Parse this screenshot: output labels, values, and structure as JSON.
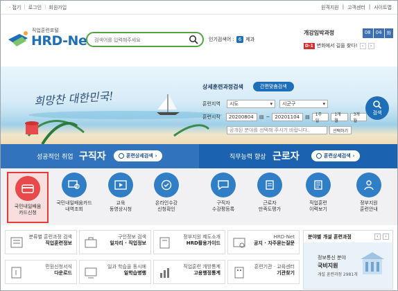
{
  "topbar": {
    "left_links": [
      "· 접기",
      "로그인",
      "회원가입"
    ],
    "right_links": [
      "원격지원",
      "고객센터",
      "사이트맵"
    ]
  },
  "logo": {
    "sub": "직업훈련포털",
    "main": "HRD-Net"
  },
  "search": {
    "placeholder": "검색어를 입력해주세요"
  },
  "popular": {
    "label": "인기검색어 :",
    "rank": "6",
    "term": "제과"
  },
  "deadline": {
    "title": "개강임박과정",
    "date": [
      "08",
      "04",
      "화"
    ],
    "badge": "D-1",
    "text": "변화에서 길을 찾다!"
  },
  "hero": {
    "slogan": "희망찬 대한민국!"
  },
  "panel": {
    "title": "상세훈련과정검색",
    "simple_btn": "간편맞춤검색",
    "region_label": "훈련지역",
    "region_sel": "시도",
    "district_sel": "시군구",
    "start_label": "훈련시작",
    "start_from": "20200804",
    "start_to": "20201104",
    "periods": [
      "1주일",
      "1개월",
      "3개월"
    ],
    "keyword_placeholder": "공개된 분야를 선택해 주시기 바랍니다.",
    "pick_btn": "선택하기",
    "search_btn": "검색"
  },
  "band": {
    "left_small": "성공적인 취업",
    "left_big": "구직자",
    "left_btn": "훈련상세검색",
    "right_small": "직무능력 향상",
    "right_big": "근로자",
    "right_btn": "훈련상세검색"
  },
  "services": [
    {
      "l1": "국민내일배움",
      "l2": "카드신청",
      "icon": "card-icon"
    },
    {
      "l1": "국민내일배움카드",
      "l2": "내역조회",
      "icon": "card-search-icon"
    },
    {
      "l1": "교육",
      "l2": "동영상시청",
      "icon": "video-icon"
    },
    {
      "l1": "온라인수강",
      "l2": "신청확인",
      "icon": "check-icon"
    },
    {
      "l1": "구직자",
      "l2": "수강평등록",
      "icon": "chat-icon"
    },
    {
      "l1": "근로자",
      "l2": "만족도평가",
      "icon": "survey-icon"
    },
    {
      "l1": "직업훈련",
      "l2": "이력보기",
      "icon": "history-icon"
    },
    {
      "l1": "정부지원",
      "l2": "훈련안내",
      "icon": "guide-icon"
    }
  ],
  "grid": [
    {
      "a": "분류별 훈련과정 검색",
      "b": "직업훈련정보",
      "icon": "list-icon"
    },
    {
      "a": "구인정보 검색",
      "b": "일자리 · 직업정보",
      "icon": "job-icon"
    },
    {
      "a": "정부지원 제도소개",
      "b": "HRD활용가이드",
      "icon": "guide-book-icon"
    },
    {
      "a": "HRD-Net",
      "b": "공지 · 자주묻는질문",
      "icon": "notice-icon"
    },
    {
      "a": "민원신청서식",
      "b": "다운로드",
      "icon": "download-icon"
    },
    {
      "a": "일과 학습을 동시에",
      "b": "일학습병행",
      "icon": "work-learn-icon"
    },
    {
      "a": "직업훈련 개방통계",
      "b": "고용행정통계",
      "icon": "stats-icon"
    },
    {
      "a": "훈련기관 · 교육센터",
      "b": "기관찾기",
      "icon": "building-icon"
    }
  ],
  "aside": {
    "title": "분야별 개설 훈련과정",
    "l1": "정보통신 분야",
    "l2": "국비지원",
    "l3": "개설 훈련과정 2981개"
  },
  "colors": {
    "primary": "#1f6fb8",
    "green": "#52a440",
    "red": "#e5393a"
  }
}
